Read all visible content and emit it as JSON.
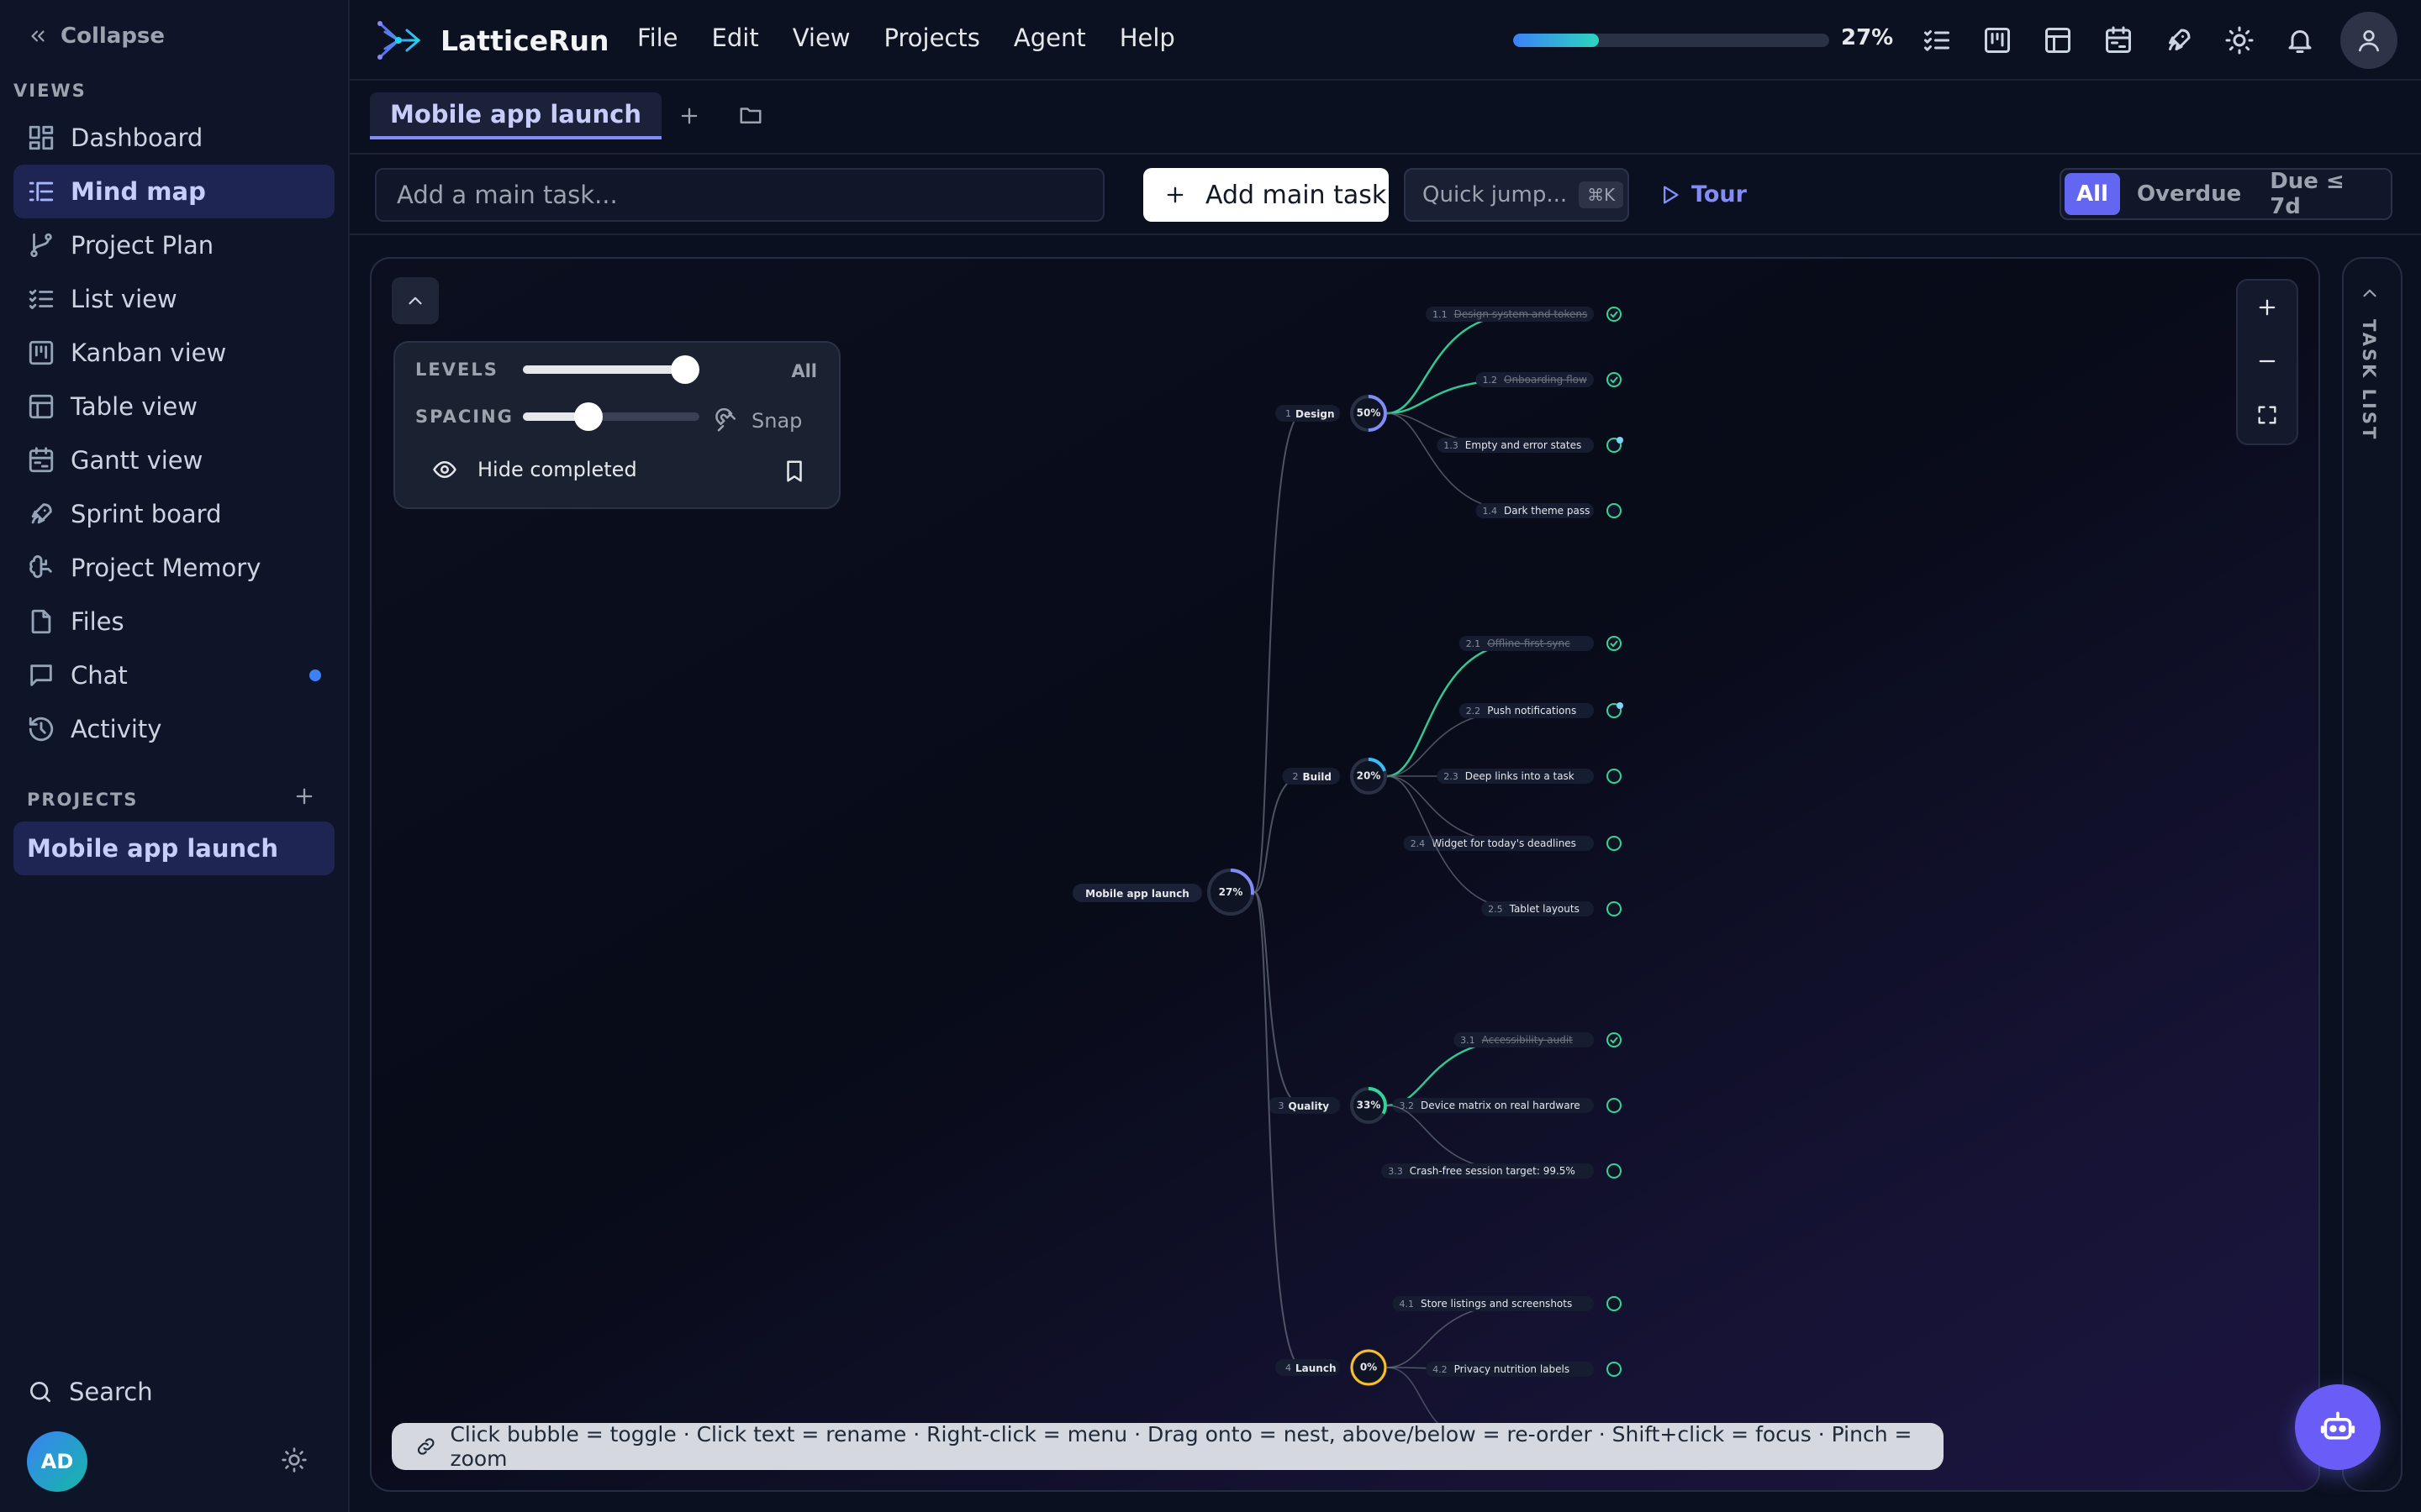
{
  "sidebar": {
    "collapse_label": "Collapse",
    "views_label": "VIEWS",
    "items": [
      {
        "label": "Dashboard",
        "icon": "dashboard-icon"
      },
      {
        "label": "Mind map",
        "icon": "mindmap-icon",
        "active": true
      },
      {
        "label": "Project Plan",
        "icon": "branch-icon"
      },
      {
        "label": "List view",
        "icon": "list-icon"
      },
      {
        "label": "Kanban view",
        "icon": "kanban-icon"
      },
      {
        "label": "Table view",
        "icon": "table-icon"
      },
      {
        "label": "Gantt view",
        "icon": "calendar-icon"
      },
      {
        "label": "Sprint board",
        "icon": "rocket-icon"
      },
      {
        "label": "Project Memory",
        "icon": "brain-icon"
      },
      {
        "label": "Files",
        "icon": "file-icon"
      },
      {
        "label": "Chat",
        "icon": "chat-icon",
        "unread": true
      },
      {
        "label": "Activity",
        "icon": "history-icon"
      }
    ],
    "projects_label": "PROJECTS",
    "projects": [
      {
        "label": "Mobile app launch",
        "active": true
      }
    ],
    "search_label": "Search",
    "user_initials": "AD"
  },
  "topbar": {
    "app_name": "LatticeRun",
    "menu": [
      "File",
      "Edit",
      "View",
      "Projects",
      "Agent",
      "Help"
    ],
    "progress_percent": 27,
    "progress_label": "27%"
  },
  "tabs": {
    "active_label": "Mobile app launch"
  },
  "toolbar": {
    "main_task_placeholder": "Add a main task...",
    "add_main_label": "Add main task",
    "quick_jump_label": "Quick jump...",
    "quick_jump_shortcut": "⌘K",
    "tour_label": "Tour",
    "filters": [
      "All",
      "Overdue",
      "Due ≤ 7d"
    ],
    "active_filter": "All"
  },
  "controls": {
    "levels_label": "LEVELS",
    "levels_value": "All",
    "levels_fraction": 0.92,
    "spacing_label": "SPACING",
    "spacing_fraction": 0.37,
    "snap_label": "Snap",
    "hide_completed_label": "Hide completed"
  },
  "hint_text": "Click bubble = toggle · Click text = rename · Right-click = menu · Drag onto = nest, above/below = re-order · Shift+click = focus · Pinch = zoom",
  "tasklist_label": "TASK LIST",
  "mindmap": {
    "root": {
      "title": "Mobile app launch",
      "progress_label": "27%",
      "progress": 0.27
    },
    "branches": [
      {
        "num": "1",
        "title": "Design",
        "progress_label": "50%",
        "progress": 0.5,
        "color": "#818cf8",
        "children": [
          {
            "num": "1.1",
            "title": "Design system and tokens",
            "done": true
          },
          {
            "num": "1.2",
            "title": "Onboarding flow",
            "done": true
          },
          {
            "num": "1.3",
            "title": "Empty and error states",
            "done": false,
            "flag": true
          },
          {
            "num": "1.4",
            "title": "Dark theme pass",
            "done": false
          }
        ]
      },
      {
        "num": "2",
        "title": "Build",
        "progress_label": "20%",
        "progress": 0.2,
        "color": "#38bdf8",
        "children": [
          {
            "num": "2.1",
            "title": "Offline-first sync",
            "done": true
          },
          {
            "num": "2.2",
            "title": "Push notifications",
            "done": false,
            "flag": true
          },
          {
            "num": "2.3",
            "title": "Deep links into a task",
            "done": false
          },
          {
            "num": "2.4",
            "title": "Widget for today's deadlines",
            "done": false
          },
          {
            "num": "2.5",
            "title": "Tablet layouts",
            "done": false
          }
        ]
      },
      {
        "num": "3",
        "title": "Quality",
        "progress_label": "33%",
        "progress": 0.33,
        "color": "#34d399",
        "children": [
          {
            "num": "3.1",
            "title": "Accessibility audit",
            "done": true
          },
          {
            "num": "3.2",
            "title": "Device matrix on real hardware",
            "done": false
          },
          {
            "num": "3.3",
            "title": "Crash-free session target: 99.5%",
            "done": false
          }
        ]
      },
      {
        "num": "4",
        "title": "Launch",
        "progress_label": "0%",
        "progress": 0.0,
        "color": "#fbbf24",
        "children": [
          {
            "num": "4.1",
            "title": "Store listings and screenshots",
            "done": false
          },
          {
            "num": "4.2",
            "title": "Privacy nutrition labels",
            "done": false
          }
        ]
      }
    ]
  },
  "colors": {
    "accent": "#6366f1",
    "done_link": "#34d399",
    "pending_link": "#6b7280"
  }
}
